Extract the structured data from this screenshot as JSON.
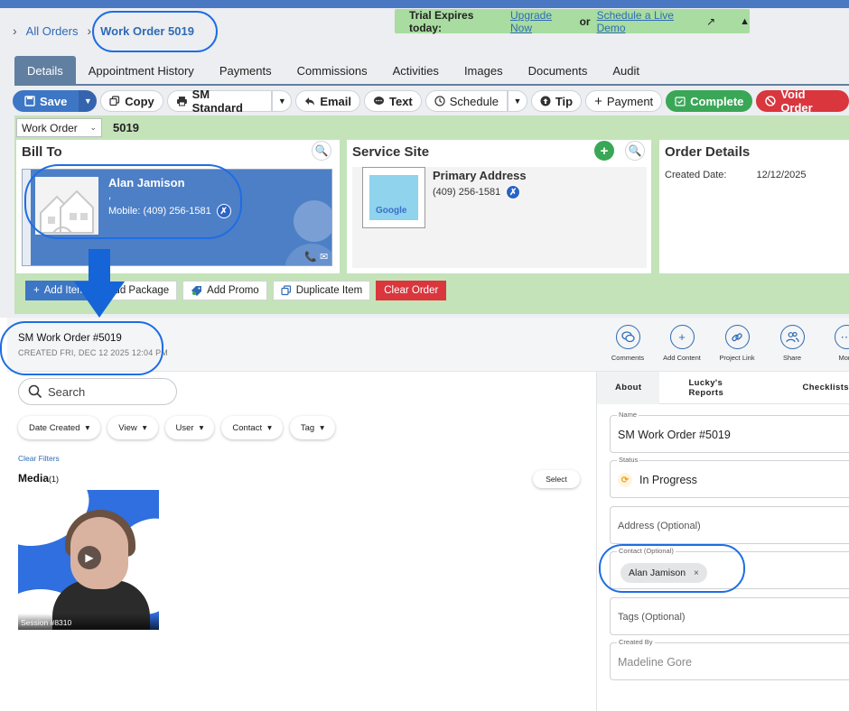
{
  "trial": {
    "expires_text": "Trial Expires today:",
    "upgrade_link": "Upgrade Now",
    "or_text": "or",
    "demo_link": "Schedule a Live Demo",
    "external_icon": "↗",
    "collapse_icon": "▲"
  },
  "breadcrumb": {
    "chevron": "›",
    "all_orders": "All Orders",
    "current": "Work Order 5019"
  },
  "tabs": [
    {
      "label": "Details"
    },
    {
      "label": "Appointment History"
    },
    {
      "label": "Payments"
    },
    {
      "label": "Commissions"
    },
    {
      "label": "Activities"
    },
    {
      "label": "Images"
    },
    {
      "label": "Documents"
    },
    {
      "label": "Audit"
    }
  ],
  "toolbar": {
    "save": "Save",
    "copy": "Copy",
    "sm_standard": "SM Standard",
    "email": "Email",
    "text": "Text",
    "schedule": "Schedule",
    "tip": "Tip",
    "payment": "Payment",
    "complete": "Complete",
    "void": "Void Order",
    "dropdown_glyph": "▼"
  },
  "order_type": {
    "label": "Work Order",
    "arrow": "⌄",
    "number": "5019"
  },
  "bill_to": {
    "title": "Bill To",
    "search_icon": "🔍",
    "name": "Alan Jamison",
    "comma": ",",
    "mobile": "Mobile: (409) 256-1581",
    "phone_icon": "📞",
    "mail_icon": "✉"
  },
  "service_site": {
    "title": "Service Site",
    "add_icon": "+",
    "search_icon": "🔍",
    "address_title": "Primary Address",
    "phone": "(409) 256-1581",
    "map_label": "Google"
  },
  "order_details": {
    "title": "Order Details",
    "created_label": "Created Date:",
    "created_value": "12/12/2025"
  },
  "action_buttons": {
    "add_item": "Add Item",
    "add_package": "Add Package",
    "add_promo": "Add Promo",
    "duplicate": "Duplicate Item",
    "clear": "Clear Order"
  },
  "sm": {
    "title": "SM Work Order #5019",
    "created": "CREATED FRI, DEC 12 2025 12:04 PM",
    "header_actions": [
      {
        "label": "Comments",
        "icon": "💬"
      },
      {
        "label": "Add Content",
        "icon": "+"
      },
      {
        "label": "Project Link",
        "icon": "🔗"
      },
      {
        "label": "Share",
        "icon": "👥"
      },
      {
        "label": "More",
        "icon": "⋯"
      }
    ],
    "search_placeholder": "Search",
    "filters": [
      {
        "label": "Date Created"
      },
      {
        "label": "View"
      },
      {
        "label": "User"
      },
      {
        "label": "Contact"
      },
      {
        "label": "Tag"
      }
    ],
    "clear_filters": "Clear Filters",
    "media_label": "Media",
    "media_count": "(1)",
    "select_label": "Select",
    "video_caption": "Session #8310",
    "right_tabs": [
      {
        "label": "About"
      },
      {
        "label": "Lucky's Reports"
      },
      {
        "label": "Checklists"
      }
    ],
    "fields": {
      "name_label": "Name",
      "name_value": "SM Work Order #5019",
      "status_label": "Status",
      "status_value": "In Progress",
      "address_placeholder": "Address (Optional)",
      "contact_label": "Contact (Optional)",
      "contact_value": "Alan Jamison",
      "contact_remove": "×",
      "tags_placeholder": "Tags (Optional)",
      "created_by_label": "Created By",
      "created_by_value": "Madeline Gore"
    }
  },
  "colors": {
    "accent_blue": "#3d76c5",
    "success_green": "#3aa757",
    "danger_red": "#d9363e",
    "annotation_blue": "#1e6de3",
    "band_green": "#c4e3b9"
  }
}
